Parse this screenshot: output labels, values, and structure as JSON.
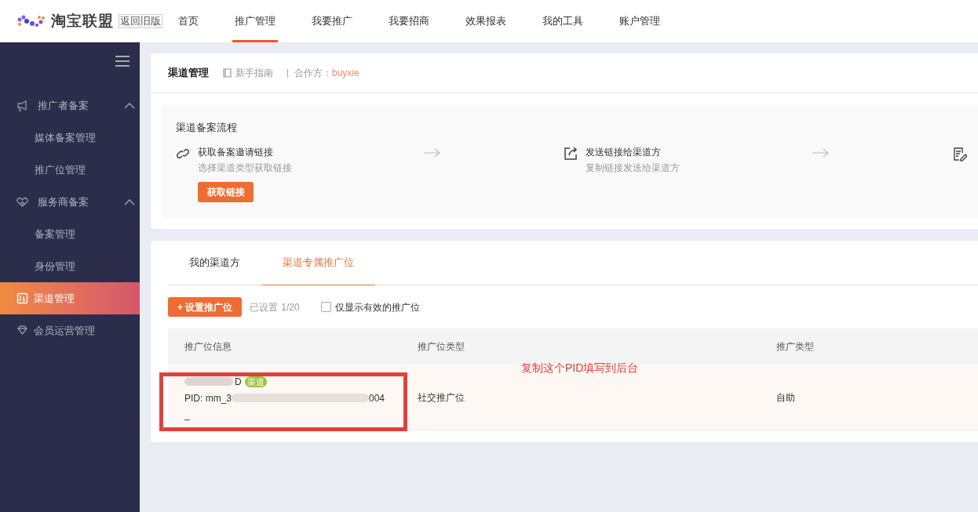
{
  "header": {
    "logo_text": "淘宝联盟",
    "old_version": "返回旧版",
    "nav": [
      {
        "label": "首页",
        "selected": false
      },
      {
        "label": "推广管理",
        "selected": true
      },
      {
        "label": "我要推广",
        "selected": false
      },
      {
        "label": "我要招商",
        "selected": false
      },
      {
        "label": "效果报表",
        "selected": false
      },
      {
        "label": "我的工具",
        "selected": false
      },
      {
        "label": "账户管理",
        "selected": false
      }
    ]
  },
  "sidebar": {
    "items": [
      {
        "label": "推广者备案",
        "selected": false,
        "expanded": true,
        "children": [
          {
            "label": "媒体备案管理",
            "selected": false
          },
          {
            "label": "推广位管理",
            "selected": false
          }
        ]
      },
      {
        "label": "服务商备案",
        "selected": false,
        "expanded": true,
        "children": [
          {
            "label": "备案管理",
            "selected": false
          },
          {
            "label": "身份管理",
            "selected": false
          }
        ]
      },
      {
        "label": "渠道管理",
        "selected": true
      },
      {
        "label": "会员运营管理",
        "selected": false
      }
    ]
  },
  "page": {
    "title": "渠道管理",
    "guide": "新手指南",
    "partner_label": "合作方：",
    "partner": "buyxie"
  },
  "process": {
    "title": "渠道备案流程",
    "steps": [
      {
        "title": "获取备案邀请链接",
        "desc": "选择渠道类型获取链接",
        "button": "获取链接"
      },
      {
        "title": "发送链接给渠道方",
        "desc": "复制链接发送给渠道方"
      }
    ]
  },
  "tabs": [
    {
      "label": "我的渠道方",
      "selected": false
    },
    {
      "label": "渠道专属推广位",
      "selected": true
    }
  ],
  "toolbar": {
    "add_button": "+ 设置推广位",
    "count_label": "已设置",
    "count": "1/20",
    "filter": {
      "label": "仅显示有效的推广位",
      "checked": false
    }
  },
  "table": {
    "columns": [
      "推广位信息",
      "推广位类型",
      "推广类型"
    ],
    "rows": [
      {
        "name_visible": "D",
        "tag": "渠道",
        "pid_start": "PID: mm_3",
        "pid_end": "004",
        "pid_line2": "_",
        "type": "社交推广位",
        "promo_type": "自助",
        "highlighted": true
      }
    ]
  },
  "annotation": "复制这个PID填写到后台"
}
